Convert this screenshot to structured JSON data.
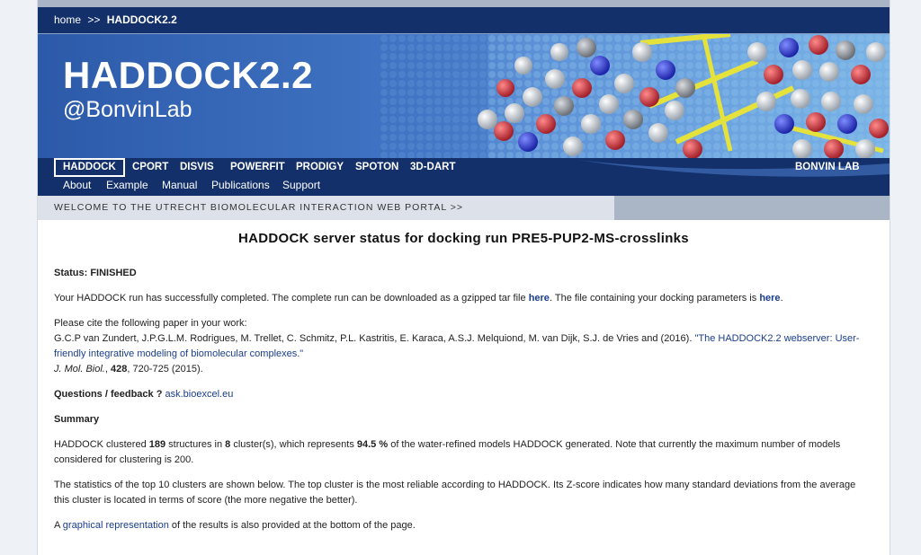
{
  "breadcrumb": {
    "home": "home",
    "separator": ">>",
    "current": "HADDOCK2.2"
  },
  "banner": {
    "title": "HADDOCK2.2",
    "subtitle": "@BonvinLab"
  },
  "nav_primary": {
    "items": [
      "HADDOCK",
      "CPORT",
      "DISVIS",
      "POWERFIT",
      "PRODIGY",
      "SPOTON",
      "3D-DART"
    ],
    "active": "HADDOCK",
    "right_label": "BONVIN LAB"
  },
  "nav_secondary": {
    "items": [
      "About",
      "Example",
      "Manual",
      "Publications",
      "Support"
    ]
  },
  "welcome": "WELCOME TO THE UTRECHT BIOMOLECULAR INTERACTION WEB PORTAL >>",
  "content": {
    "heading": "HADDOCK server status for docking run PRE5-PUP2-MS-crosslinks",
    "status_label": "Status: FINISHED",
    "completed_pre": "Your HADDOCK run has successfully completed. The complete run can be downloaded as a gzipped tar file ",
    "completed_link1": "here",
    "completed_mid": ". The file containing your docking parameters is ",
    "completed_link2": "here",
    "completed_post": ".",
    "cite_intro": "Please cite the following paper in your work:",
    "cite_authors": "G.C.P van Zundert, J.P.G.L.M. Rodrigues, M. Trellet, C. Schmitz, P.L. Kastritis, E. Karaca, A.S.J. Melquiond, M. van Dijk, S.J. de Vries and (2016). ",
    "cite_title": "\"The HADDOCK2.2 webserver: User-friendly integrative modeling of biomolecular complexes.\"",
    "cite_journal": "J. Mol. Biol.",
    "cite_sep": ", ",
    "cite_volume": "428",
    "cite_pages": ", 720-725 (2015).",
    "questions_label": "Questions / feedback ?",
    "questions_link": "ask.bioexcel.eu",
    "summary_label": "Summary",
    "summary_p1_a": "HADDOCK clustered ",
    "summary_structures": "189",
    "summary_p1_b": " structures in ",
    "summary_clusters": "8",
    "summary_p1_c": " cluster(s), which represents ",
    "summary_percent": "94.5 %",
    "summary_p1_d": " of the water-refined models HADDOCK generated. Note that currently the maximum number of models considered for clustering is 200.",
    "summary_p2": "The statistics of the top 10 clusters are shown below. The top cluster is the most reliable according to HADDOCK. Its Z-score indicates how many standard deviations from the average this cluster is located in terms of score (the more negative the better).",
    "summary_p3_pre": "A ",
    "summary_p3_link": "graphical representation",
    "summary_p3_post": " of the results is also provided at the bottom of the page."
  }
}
